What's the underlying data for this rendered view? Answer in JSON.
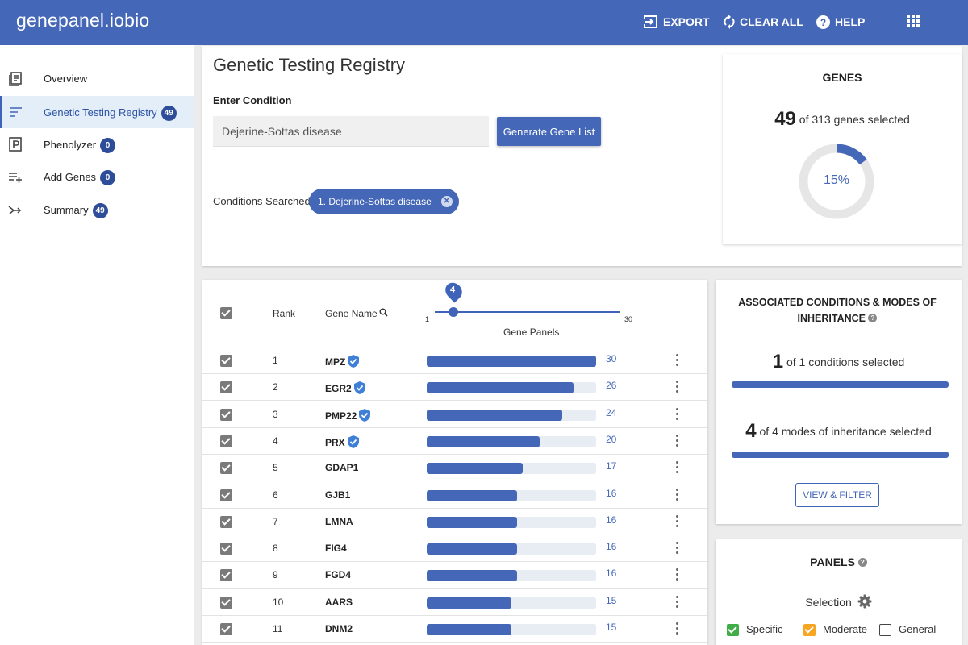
{
  "header": {
    "app_title": "genepanel.iobio",
    "export_label": "EXPORT",
    "clear_label": "CLEAR ALL",
    "help_label": "HELP",
    "brand_color": "#4567b7"
  },
  "sidebar": {
    "items": [
      {
        "label": "Overview",
        "icon": "document-icon",
        "badge": null
      },
      {
        "label": "Genetic Testing Registry",
        "icon": "sort-lines-icon",
        "badge": "49",
        "active": true
      },
      {
        "label": "Phenolyzer",
        "icon": "p-box-icon",
        "badge": "0"
      },
      {
        "label": "Add Genes",
        "icon": "playlist-add-icon",
        "badge": "0"
      },
      {
        "label": "Summary",
        "icon": "merge-arrow-icon",
        "badge": "49"
      }
    ]
  },
  "registry": {
    "title": "Genetic Testing Registry",
    "enter_label": "Enter Condition",
    "condition_value": "Dejerine-Sottas disease",
    "generate_label": "Generate Gene List",
    "searched_label": "Conditions Searched:",
    "chip_label": "1. Dejerine-Sottas disease"
  },
  "genes_card": {
    "title": "GENES",
    "selected": "49",
    "summary": "of 313 genes selected",
    "percent_label": "15%",
    "percent_value": 0.15
  },
  "table": {
    "headers": {
      "rank": "Rank",
      "gene_name": "Gene Name",
      "gene_panels": "Gene Panels"
    },
    "slider": {
      "value": "4",
      "min": "1",
      "max": "30"
    },
    "max_panels": 30,
    "rows": [
      {
        "rank": "1",
        "gene": "MPZ",
        "verified": true,
        "panels": 30
      },
      {
        "rank": "2",
        "gene": "EGR2",
        "verified": true,
        "panels": 26
      },
      {
        "rank": "3",
        "gene": "PMP22",
        "verified": true,
        "panels": 24
      },
      {
        "rank": "4",
        "gene": "PRX",
        "verified": true,
        "panels": 20
      },
      {
        "rank": "5",
        "gene": "GDAP1",
        "verified": false,
        "panels": 17
      },
      {
        "rank": "6",
        "gene": "GJB1",
        "verified": false,
        "panels": 16
      },
      {
        "rank": "7",
        "gene": "LMNA",
        "verified": false,
        "panels": 16
      },
      {
        "rank": "8",
        "gene": "FIG4",
        "verified": false,
        "panels": 16
      },
      {
        "rank": "9",
        "gene": "FGD4",
        "verified": false,
        "panels": 16
      },
      {
        "rank": "10",
        "gene": "AARS",
        "verified": false,
        "panels": 15
      },
      {
        "rank": "11",
        "gene": "DNM2",
        "verified": false,
        "panels": 15
      }
    ]
  },
  "assoc_card": {
    "title": "ASSOCIATED CONDITIONS & MODES OF INHERITANCE",
    "cond_selected": "1",
    "cond_summary": "of 1 conditions selected",
    "modes_selected": "4",
    "modes_summary": "of 4 modes of inheritance selected",
    "button_label": "VIEW & FILTER"
  },
  "panels_card": {
    "title": "PANELS",
    "selection_label": "Selection",
    "options": [
      {
        "label": "Specific",
        "checked": true,
        "color": "#3fae49"
      },
      {
        "label": "Moderate",
        "checked": true,
        "color": "#f5a623"
      },
      {
        "label": "General",
        "checked": false,
        "color": "#ffffff"
      }
    ]
  }
}
